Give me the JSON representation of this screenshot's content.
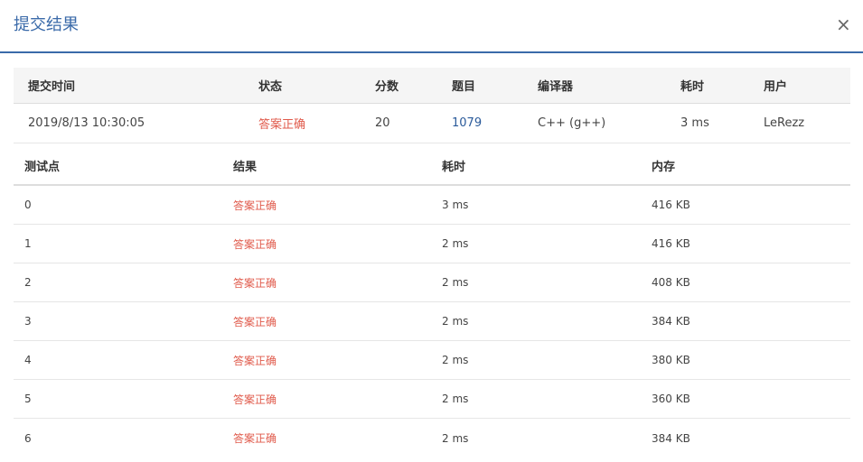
{
  "modal": {
    "title": "提交结果",
    "close_glyph": "×"
  },
  "summary": {
    "headers": {
      "time": "提交时间",
      "status": "状态",
      "score": "分数",
      "problem": "题目",
      "compiler": "编译器",
      "duration": "耗时",
      "user": "用户"
    },
    "row": {
      "time": "2019/8/13 10:30:05",
      "status": "答案正确",
      "score": "20",
      "problem": "1079",
      "compiler": "C++ (g++)",
      "duration": "3 ms",
      "user": "LeRezz"
    }
  },
  "cases": {
    "headers": {
      "id": "测试点",
      "result": "结果",
      "duration": "耗时",
      "memory": "内存"
    },
    "rows": [
      {
        "id": "0",
        "result": "答案正确",
        "duration": "3 ms",
        "memory": "416 KB"
      },
      {
        "id": "1",
        "result": "答案正确",
        "duration": "2 ms",
        "memory": "416 KB"
      },
      {
        "id": "2",
        "result": "答案正确",
        "duration": "2 ms",
        "memory": "408 KB"
      },
      {
        "id": "3",
        "result": "答案正确",
        "duration": "2 ms",
        "memory": "384 KB"
      },
      {
        "id": "4",
        "result": "答案正确",
        "duration": "2 ms",
        "memory": "380 KB"
      },
      {
        "id": "5",
        "result": "答案正确",
        "duration": "2 ms",
        "memory": "360 KB"
      },
      {
        "id": "6",
        "result": "答案正确",
        "duration": "2 ms",
        "memory": "384 KB"
      }
    ]
  },
  "colors": {
    "accent": "#3a6aa9",
    "accepted": "#e05a4b",
    "link": "#2a5a9a",
    "header_bg": "#f5f5f5"
  }
}
